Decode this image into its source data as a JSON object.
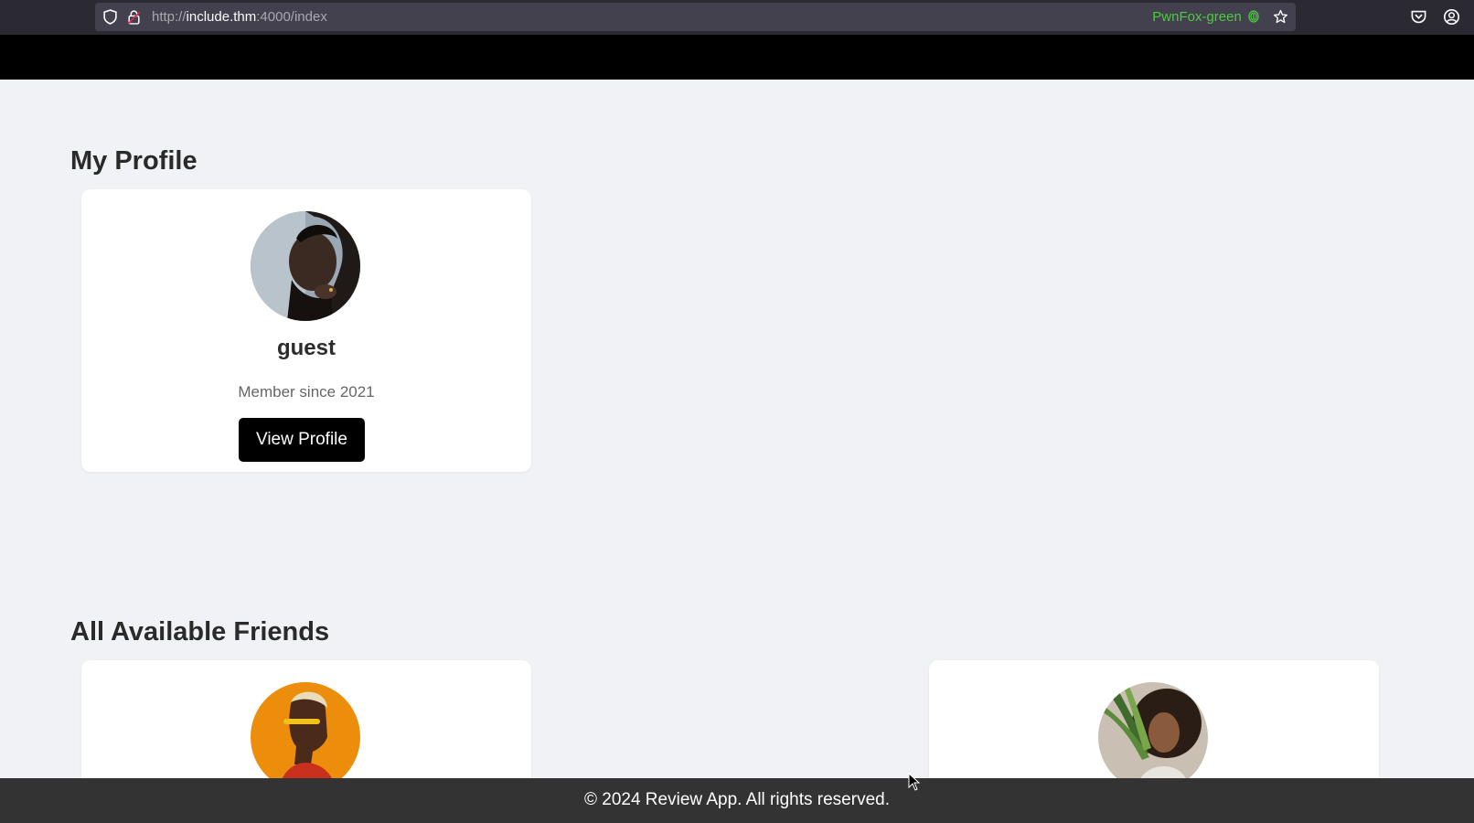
{
  "browser": {
    "url_scheme": "http://",
    "url_host": "include.thm",
    "url_rest": ":4000/index",
    "container_label": "PwnFox-green",
    "container_color": "#4ec942"
  },
  "profile_section": {
    "title": "My Profile",
    "card": {
      "name": "guest",
      "member_since": "Member since 2021",
      "button_label": "View Profile",
      "avatar": "profile-photo-man"
    }
  },
  "friends_section": {
    "title": "All Available Friends",
    "friends": [
      {
        "avatar": "friend-photo-yellow-glasses"
      },
      {
        "avatar": "friend-photo-woman-plants"
      }
    ]
  },
  "footer": {
    "text": "© 2024 Review App. All rights reserved."
  },
  "colors": {
    "page_bg": "#f0f2f5",
    "nav_bg": "#000000",
    "button_bg": "#000000",
    "footer_bg": "#333333"
  }
}
